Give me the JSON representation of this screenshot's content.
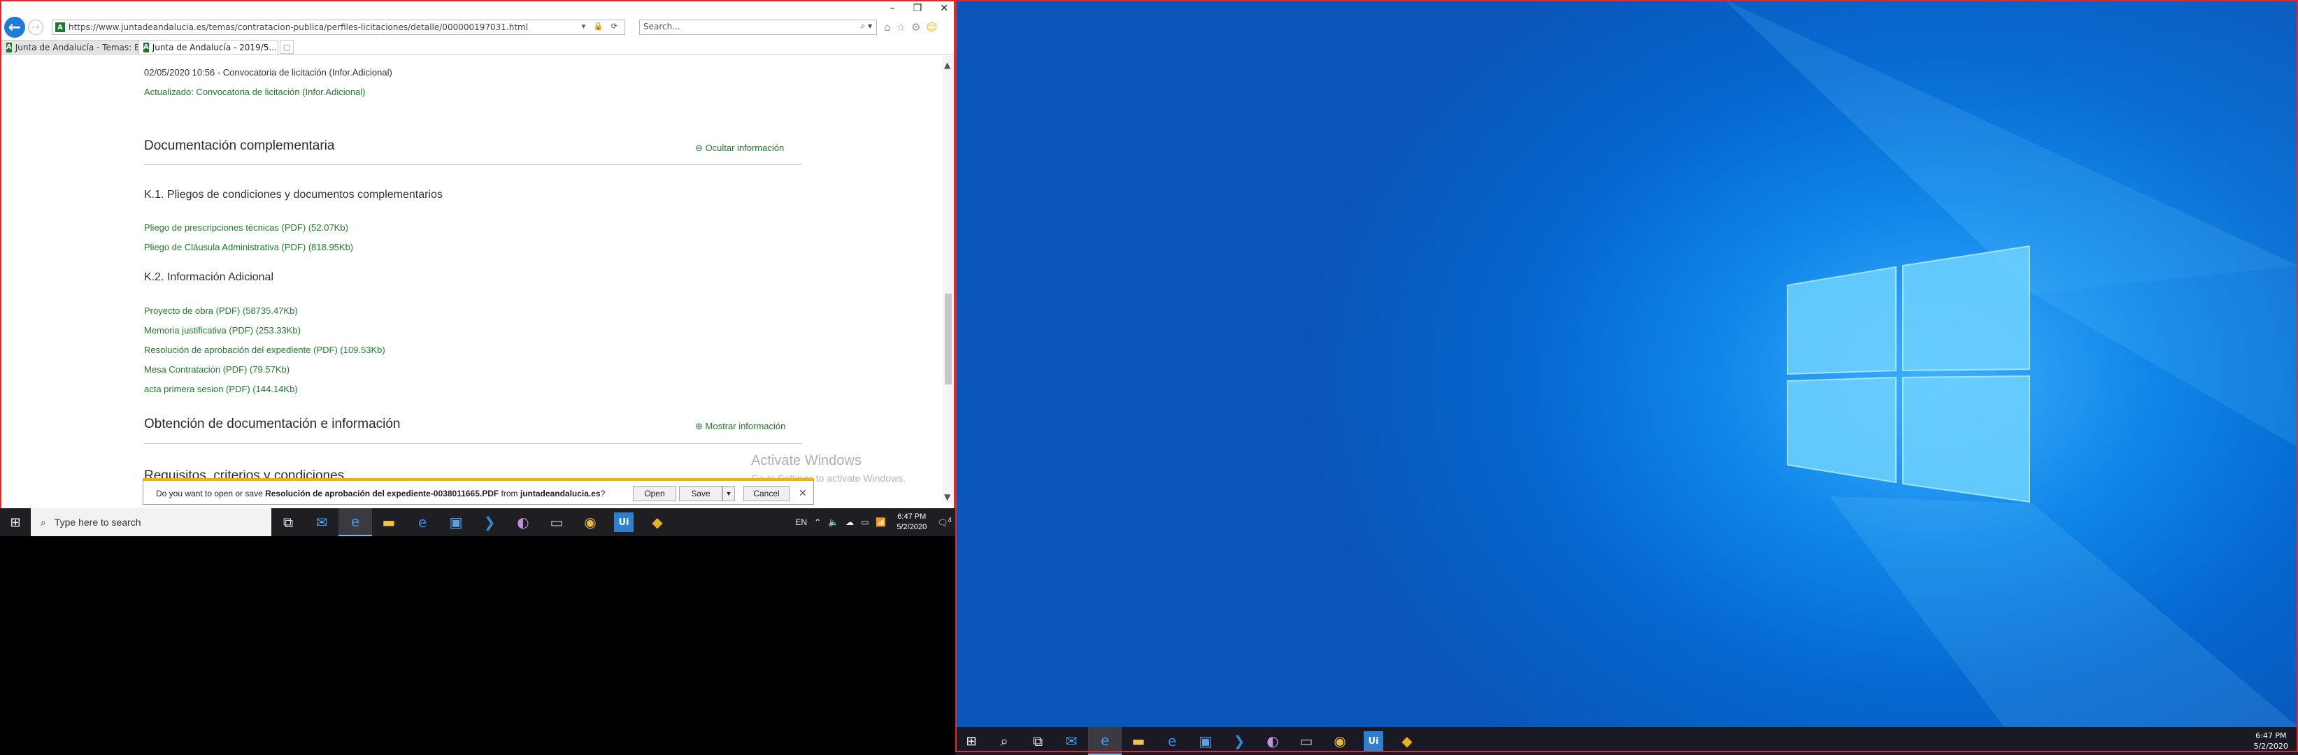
{
  "browser": {
    "url": "https://www.juntadeandalucia.es/temas/contratacion-publica/perfiles-licitaciones/detalle/000000197031.html",
    "search_placeholder": "Search...",
    "tabs": [
      {
        "label": "Junta de Andalucía - Temas: B..."
      },
      {
        "label": "Junta de Andalucía - 2019/5..."
      }
    ],
    "window_controls": [
      "–",
      "❐",
      "✕"
    ]
  },
  "page": {
    "date_line": "02/05/2020 10:56 - Convocatoria de licitación (Infor.Adicional)",
    "updated_line": "Actualizado: Convocatoria de licitación (Infor.Adicional)",
    "sections": [
      {
        "title": "Documentación complementaria",
        "action": "⊖ Ocultar información"
      },
      {
        "title": "Obtención de documentación e información",
        "action": "⊕ Mostrar información"
      },
      {
        "title": "Requisitos, criterios y condiciones",
        "action": ""
      }
    ],
    "subsections": [
      {
        "title": "K.1. Pliegos de condiciones y documentos complementarios",
        "links": [
          "Pliego de prescripciones técnicas (PDF) (52.07Kb)",
          "Pliego de Cláusula Administrativa (PDF) (818.95Kb)"
        ]
      },
      {
        "title": "K.2. Información Adicional",
        "links": [
          "Proyecto de obra (PDF) (58735.47Kb)",
          "Memoria justificativa (PDF) (253.33Kb)",
          "Resolución de aprobación del expediente (PDF) (109.53Kb)",
          "Mesa Contratación (PDF) (79.57Kb)",
          "acta primera sesion (PDF) (144.14Kb)"
        ]
      }
    ],
    "watermark_title": "Activate Windows",
    "watermark_sub": "Go to Settings to activate Windows."
  },
  "download_bar": {
    "prefix": "Do you want to open or save ",
    "filename": "Resolución de aprobación del expediente-0038011665.PDF",
    "middle": " from ",
    "source": "juntadeandalucia.es",
    "suffix": "?",
    "open_label": "Open",
    "save_label": "Save",
    "cancel_label": "Cancel"
  },
  "taskbar_left": {
    "search_placeholder": "Type here to search",
    "lang": "EN",
    "time": "6:47 PM",
    "date": "5/2/2020",
    "notification_count": "4",
    "apps": [
      "task-view-icon",
      "mail-icon",
      "ie-icon",
      "file-explorer-icon",
      "edge-icon",
      "store-icon",
      "vscode-icon",
      "app-icon",
      "terminal-icon",
      "chrome-icon",
      "uipath-icon",
      "git-icon"
    ]
  },
  "taskbar_right": {
    "time": "6:47 PM",
    "date": "5/2/2020"
  },
  "colors": {
    "link_green": "#1f7a2e",
    "taskbar": "#1f1f23",
    "accent_blue": "#1e7bd6",
    "desktop_blue": "#0f86e8"
  }
}
